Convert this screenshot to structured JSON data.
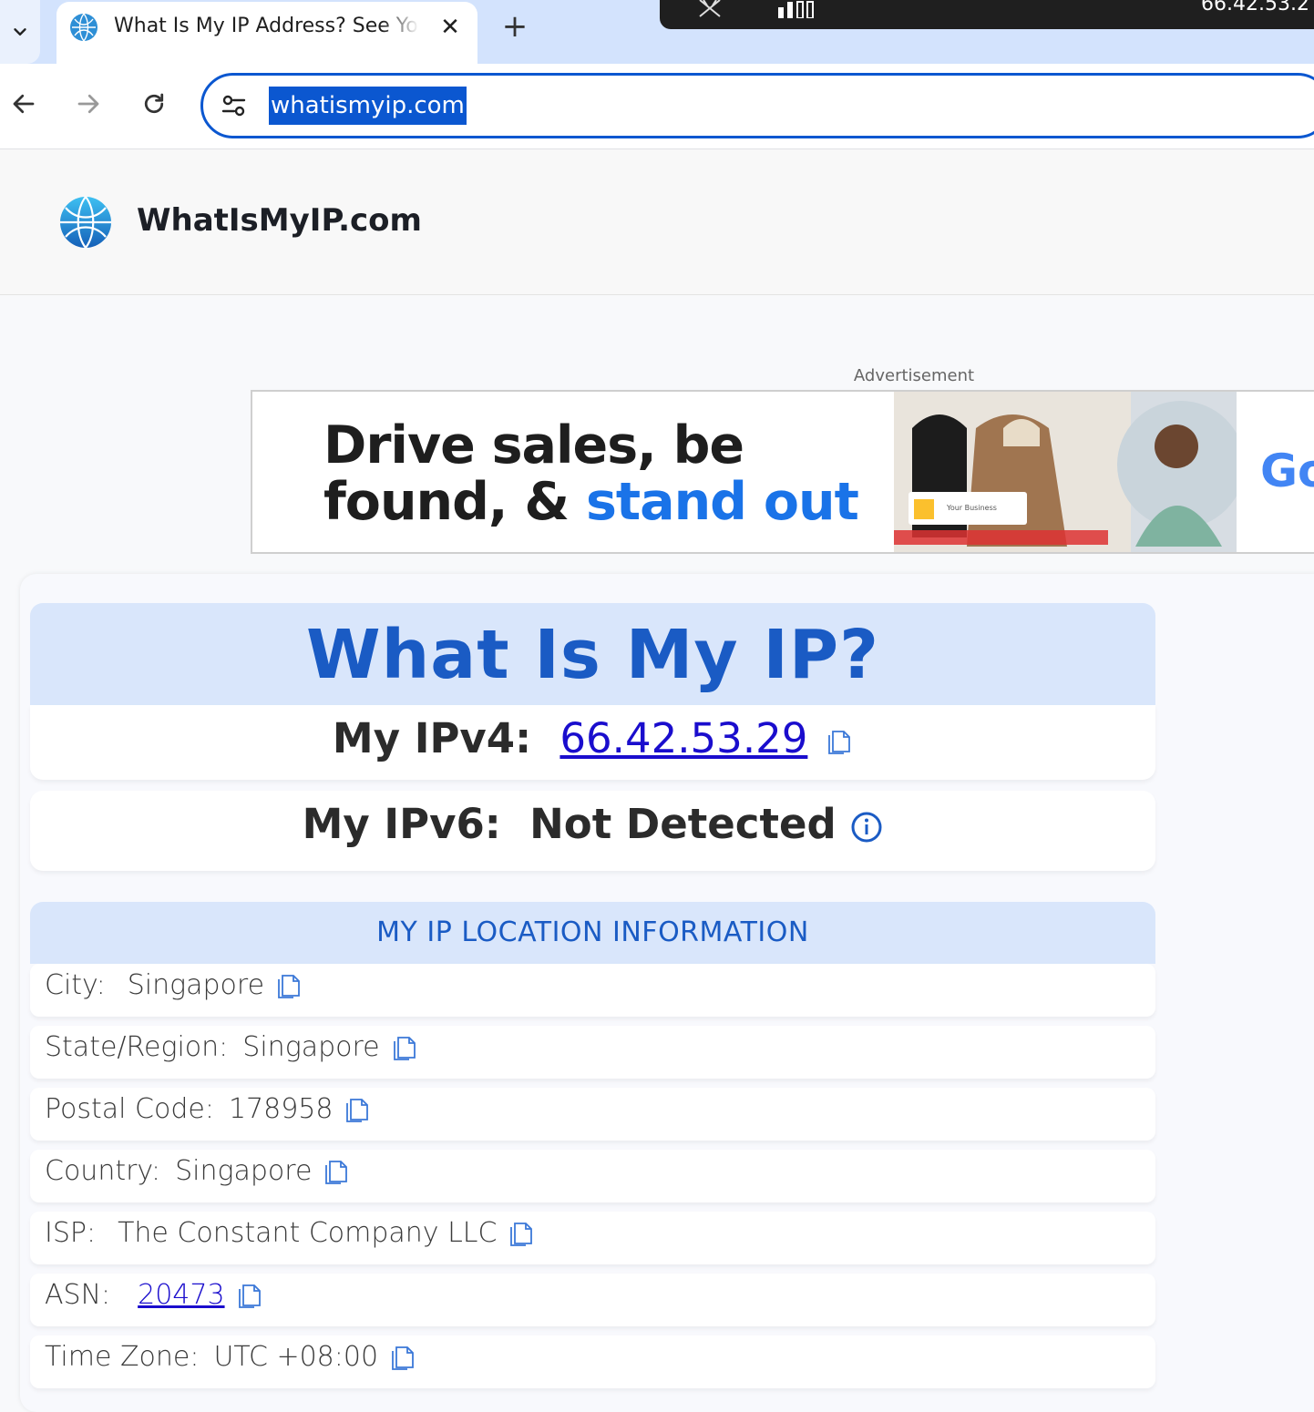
{
  "browser": {
    "tab_title": "What Is My IP Address? See Your Public Address",
    "url": "whatismyip.com",
    "overlay_ip": "66.42.53.2"
  },
  "site": {
    "name": "WhatIsMyIP.com"
  },
  "ad": {
    "label": "Advertisement",
    "headline_line1": "Drive sales, be",
    "headline_line2_a": "found, & ",
    "headline_line2_b": "stand out",
    "brand_fragment": "Go",
    "badge_text": "Your Business"
  },
  "hero": {
    "title": "What Is My IP?",
    "ipv4_label": "My IPv4:",
    "ipv4_value": "66.42.53.29",
    "ipv6_label": "My IPv6:",
    "ipv6_value": "Not Detected"
  },
  "location": {
    "title": "MY IP LOCATION INFORMATION",
    "city_label": "City:",
    "city_value": "Singapore",
    "state_label": "State/Region:",
    "state_value": "Singapore",
    "postal_label": "Postal Code:",
    "postal_value": "178958",
    "country_label": "Country:",
    "country_value": "Singapore",
    "isp_label": "ISP:",
    "isp_value": "The Constant Company LLC",
    "asn_label": "ASN:",
    "asn_value": "20473",
    "tz_label": "Time Zone:",
    "tz_value": "UTC +08:00"
  },
  "colors": {
    "accent": "#1a5bc4",
    "header_band": "#d9e6fb",
    "link": "#1a0dcd",
    "omnibox_border": "#0b57d0"
  }
}
